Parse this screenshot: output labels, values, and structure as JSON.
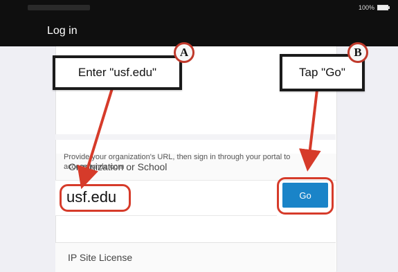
{
  "status_bar": {
    "battery": "100%"
  },
  "nav": {
    "title": "Log in"
  },
  "form": {
    "org_row_label": "Organization or School",
    "description": "Provide your organization's URL, then sign in through your portal to access lynda.com",
    "url_value": "usf.edu",
    "go_label": "Go",
    "ip_row_label": "IP Site License"
  },
  "callouts": {
    "a_text": "Enter \"usf.edu\"",
    "a_badge": "A",
    "b_text": "Tap \"Go\"",
    "b_badge": "B"
  },
  "colors": {
    "go_button": "#1a84c8",
    "annotation_red": "#d63b2a",
    "topbar": "#0f0f0f"
  },
  "icons": {
    "battery": "battery-icon"
  }
}
